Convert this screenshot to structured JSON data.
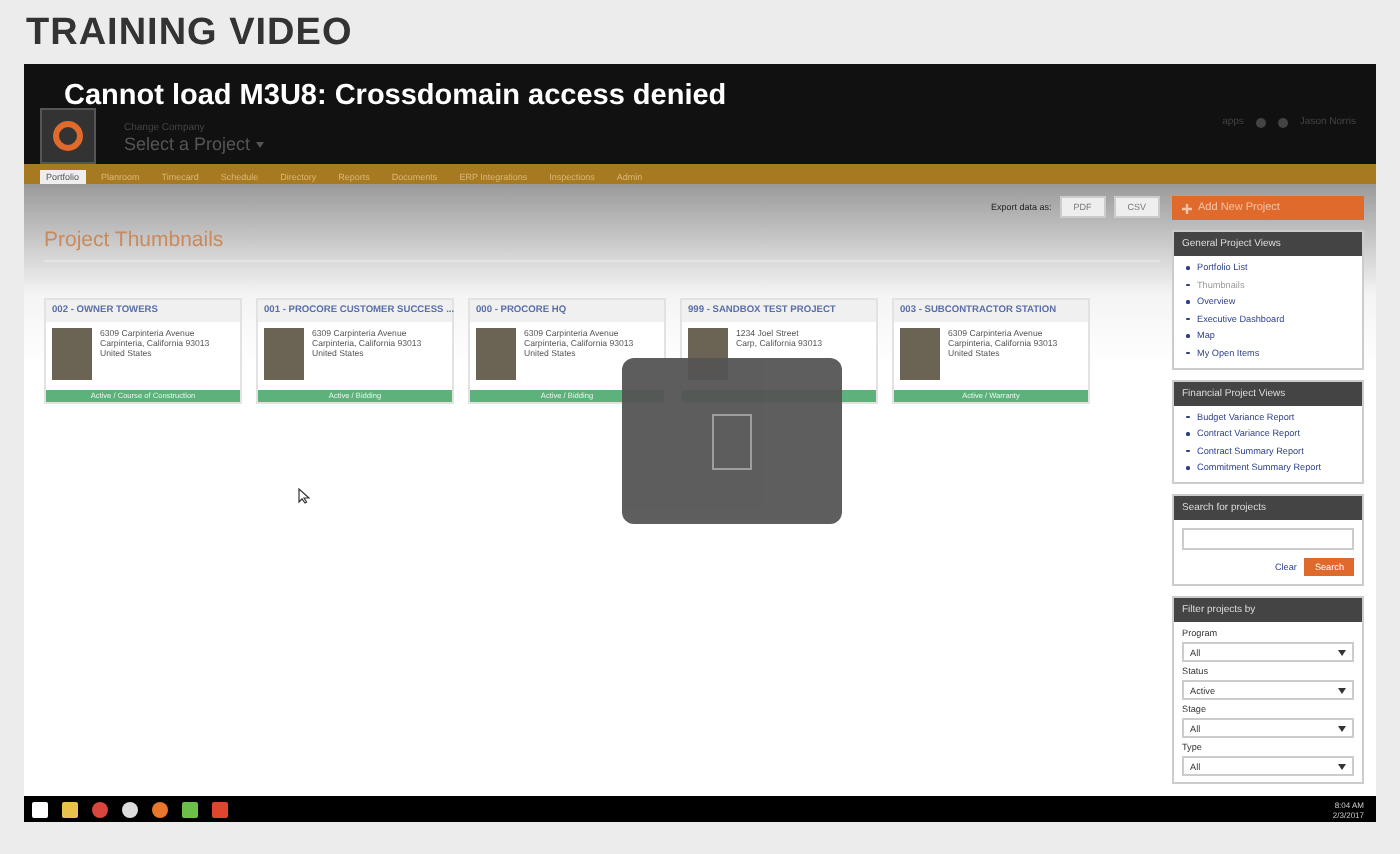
{
  "page_title": "TRAINING VIDEO",
  "video": {
    "error_message": "Cannot load M3U8: Crossdomain access denied",
    "app": {
      "company": "Change Company",
      "project_select": "Select a Project",
      "header_links": [
        "apps",
        "Jason Norris"
      ],
      "tabs": [
        {
          "label": "Portfolio",
          "selected": true
        },
        {
          "label": "Planroom",
          "selected": false
        },
        {
          "label": "Timecard",
          "selected": false
        },
        {
          "label": "Schedule",
          "selected": false
        },
        {
          "label": "Directory",
          "selected": false
        },
        {
          "label": "Reports",
          "selected": false
        },
        {
          "label": "Documents",
          "selected": false
        },
        {
          "label": "ERP Integrations",
          "selected": false
        },
        {
          "label": "Inspections",
          "selected": false
        },
        {
          "label": "Admin",
          "selected": false
        }
      ],
      "export_label": "Export data as:",
      "export_buttons": [
        "PDF",
        "CSV"
      ],
      "heading": "Project Thumbnails",
      "projects": [
        {
          "title": "002 - OWNER TOWERS",
          "address": [
            "6309 Carpinteria Avenue",
            "Carpinteria, California 93013",
            "United States"
          ],
          "status": "Active / Course of Construction"
        },
        {
          "title": "001 - PROCORE CUSTOMER SUCCESS ...",
          "address": [
            "6309 Carpinteria Avenue",
            "Carpinteria, California 93013",
            "United States"
          ],
          "status": "Active / Bidding"
        },
        {
          "title": "000 - PROCORE HQ",
          "address": [
            "6309 Carpinteria Avenue",
            "Carpinteria, California 93013",
            "United States"
          ],
          "status": "Active / Bidding"
        },
        {
          "title": "999 - SANDBOX TEST PROJECT",
          "address": [
            "1234 Joel Street",
            "Carp, California 93013"
          ]
        },
        {
          "title": "003 - SUBCONTRACTOR STATION",
          "address": [
            "6309 Carpinteria Avenue",
            "Carpinteria, California 93013",
            "United States"
          ],
          "status": "Active / Warranty"
        }
      ],
      "add_button": "Add New Project",
      "panels": [
        {
          "title": "General Project Views",
          "links": [
            {
              "label": "Portfolio List",
              "selected": false
            },
            {
              "label": "Thumbnails",
              "selected": true
            },
            {
              "label": "Overview",
              "selected": false
            },
            {
              "label": "Executive Dashboard",
              "selected": false
            },
            {
              "label": "Map",
              "selected": false
            },
            {
              "label": "My Open Items",
              "selected": false
            }
          ]
        },
        {
          "title": "Financial Project Views",
          "links": [
            {
              "label": "Budget Variance Report",
              "selected": false
            },
            {
              "label": "Contract Variance Report",
              "selected": false
            },
            {
              "label": "Contract Summary Report",
              "selected": false
            },
            {
              "label": "Commitment Summary Report",
              "selected": false
            }
          ]
        }
      ],
      "search": {
        "title": "Search for projects",
        "clear": "Clear",
        "button": "Search"
      },
      "filters": {
        "title": "Filter projects by",
        "fields": [
          {
            "label": "Program",
            "value": "All"
          },
          {
            "label": "Status",
            "value": "Active"
          },
          {
            "label": "Stage",
            "value": "All"
          },
          {
            "label": "Type",
            "value": "All"
          }
        ]
      }
    },
    "taskbar": {
      "time": "8:04 AM",
      "date": "2/3/2017"
    }
  }
}
